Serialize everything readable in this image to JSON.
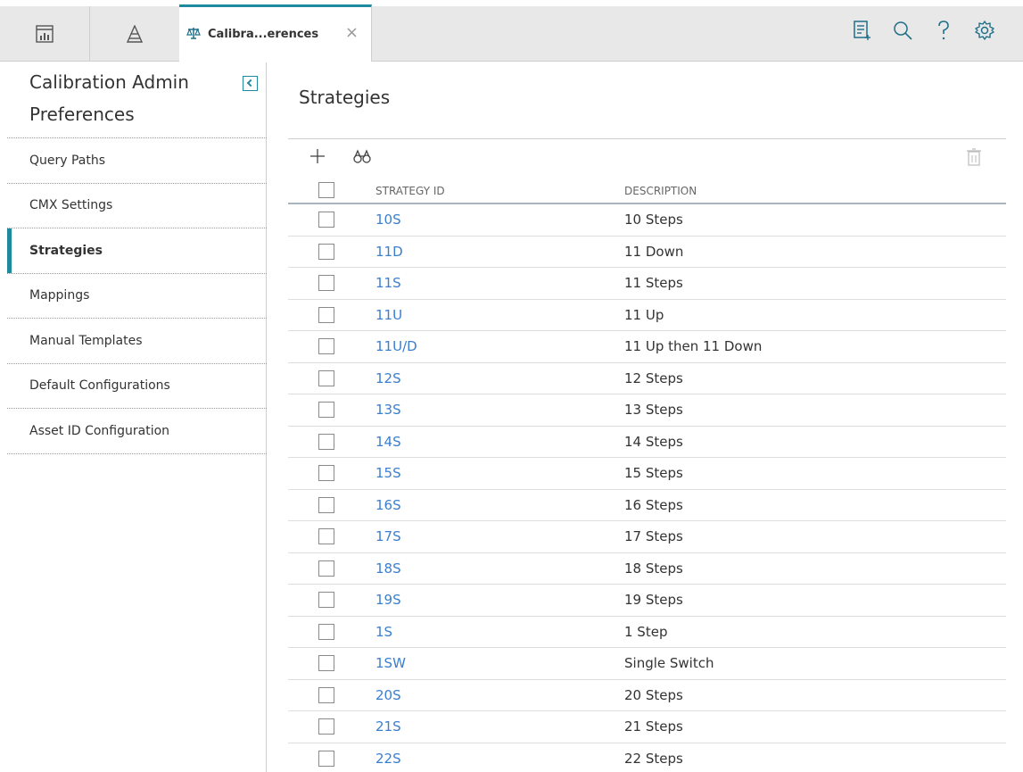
{
  "tabs": {
    "active_label": "Calibra...erences",
    "close_symbol": "×"
  },
  "sidebar": {
    "title": "Calibration Admin Preferences",
    "items": [
      {
        "label": "Query Paths"
      },
      {
        "label": "CMX Settings"
      },
      {
        "label": "Strategies",
        "active": true
      },
      {
        "label": "Mappings"
      },
      {
        "label": "Manual Templates"
      },
      {
        "label": "Default Configurations"
      },
      {
        "label": "Asset ID Configuration"
      }
    ]
  },
  "main": {
    "title": "Strategies",
    "columns": {
      "id": "STRATEGY ID",
      "description": "DESCRIPTION"
    },
    "rows": [
      {
        "id": "10S",
        "description": "10 Steps"
      },
      {
        "id": "11D",
        "description": "11 Down"
      },
      {
        "id": "11S",
        "description": "11 Steps"
      },
      {
        "id": "11U",
        "description": "11 Up"
      },
      {
        "id": "11U/D",
        "description": "11 Up then 11 Down"
      },
      {
        "id": "12S",
        "description": "12 Steps"
      },
      {
        "id": "13S",
        "description": "13 Steps"
      },
      {
        "id": "14S",
        "description": "14 Steps"
      },
      {
        "id": "15S",
        "description": "15 Steps"
      },
      {
        "id": "16S",
        "description": "16 Steps"
      },
      {
        "id": "17S",
        "description": "17 Steps"
      },
      {
        "id": "18S",
        "description": "18 Steps"
      },
      {
        "id": "19S",
        "description": "19 Steps"
      },
      {
        "id": "1S",
        "description": "1 Step"
      },
      {
        "id": "1SW",
        "description": "Single Switch"
      },
      {
        "id": "20S",
        "description": "20 Steps"
      },
      {
        "id": "21S",
        "description": "21 Steps"
      },
      {
        "id": "22S",
        "description": "22 Steps"
      }
    ]
  },
  "colors": {
    "accent": "#1f8a9e",
    "link": "#3a7fd0",
    "topbar_bg": "#e8e8e8"
  },
  "icons": {
    "tab1": "dashboard-icon",
    "tab2": "pyramid-icon",
    "active_tab": "scales-icon",
    "header_right": [
      "new-report-icon",
      "search-icon",
      "help-icon",
      "settings-gear-icon"
    ],
    "toolbar": [
      "add-icon",
      "binoculars-icon",
      "trash-icon"
    ]
  }
}
